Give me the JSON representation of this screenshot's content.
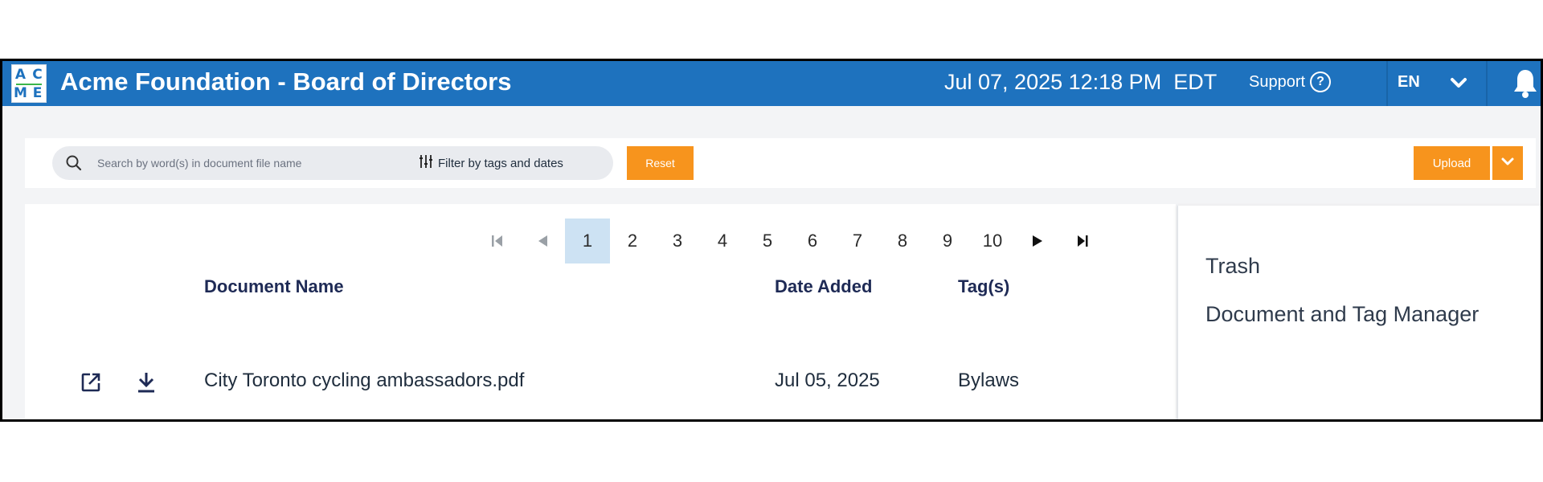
{
  "app": {
    "logo_letters": [
      "A",
      "C",
      "M",
      "E"
    ],
    "title": "Acme Foundation - Board of Directors",
    "datetime": "Jul 07, 2025 12:18 PM  EDT",
    "support_label": "Support",
    "language": "EN",
    "brand_color": "#1e72be",
    "accent_color": "#f7941d"
  },
  "toolbar": {
    "search_placeholder": "Search by word(s) in document file name",
    "filter_label": "Filter by tags and dates",
    "reset_label": "Reset",
    "upload_label": "Upload"
  },
  "pagination": {
    "pages": [
      "1",
      "2",
      "3",
      "4",
      "5",
      "6",
      "7",
      "8",
      "9",
      "10"
    ],
    "current": "1"
  },
  "table": {
    "columns": [
      "Document Name",
      "Date Added",
      "Tag(s)"
    ],
    "rows": [
      {
        "name": "City Toronto cycling ambassadors.pdf",
        "date": "Jul 05, 2025",
        "tags": "Bylaws"
      }
    ]
  },
  "side_panel": {
    "links": [
      "Trash",
      "Document and Tag Manager"
    ]
  },
  "icons": {
    "logo": "acme-logo",
    "help": "help-circle-icon",
    "language_toggle": "chevron-down-icon",
    "notifications": "bell-icon",
    "search": "search-icon",
    "filter": "sliders-icon",
    "upload_menu": "chevron-down-icon",
    "first_page": "first-page-icon",
    "prev_page": "prev-page-icon",
    "next_page": "next-page-icon",
    "last_page": "last-page-icon",
    "open": "open-external-icon",
    "download": "download-icon"
  }
}
